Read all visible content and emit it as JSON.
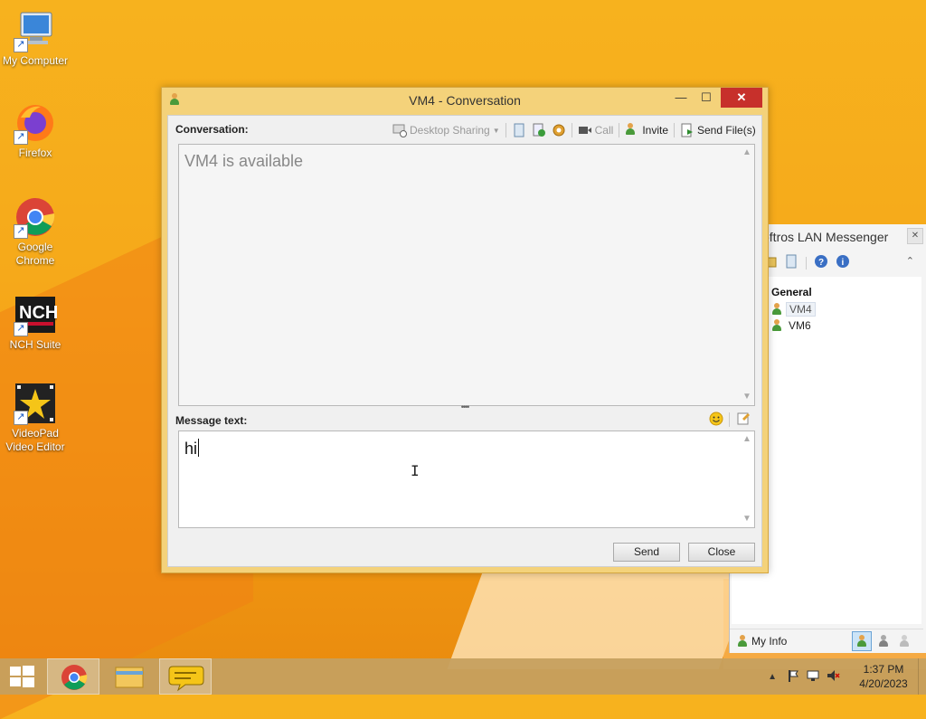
{
  "desktop": {
    "icons": [
      {
        "label": "My Computer",
        "icon": "computer-icon"
      },
      {
        "label": "Firefox",
        "icon": "firefox-icon"
      },
      {
        "label": "Google Chrome",
        "icon": "chrome-icon"
      },
      {
        "label": "NCH Suite",
        "icon": "nch-icon"
      },
      {
        "label": "VideoPad Video Editor",
        "icon": "videopad-icon"
      }
    ]
  },
  "conversation": {
    "title": "VM4 - Conversation",
    "conversation_label": "Conversation:",
    "toolbar": {
      "desktop_sharing": "Desktop Sharing",
      "call": "Call",
      "invite": "Invite",
      "send_files": "Send File(s)"
    },
    "status_text": "VM4 is available",
    "message_label": "Message text:",
    "message_value": "hi",
    "send_label": "Send",
    "close_label": "Close"
  },
  "lan": {
    "title": "oftros LAN Messenger",
    "group": "General",
    "contacts": [
      "VM4",
      "VM6"
    ],
    "my_info": "My Info"
  },
  "taskbar": {
    "time": "1:37 PM",
    "date": "4/20/2023"
  },
  "colors": {
    "accent_close": "#c7302b",
    "window_frame": "#f4d27a",
    "desktop": "#f6a91a"
  }
}
